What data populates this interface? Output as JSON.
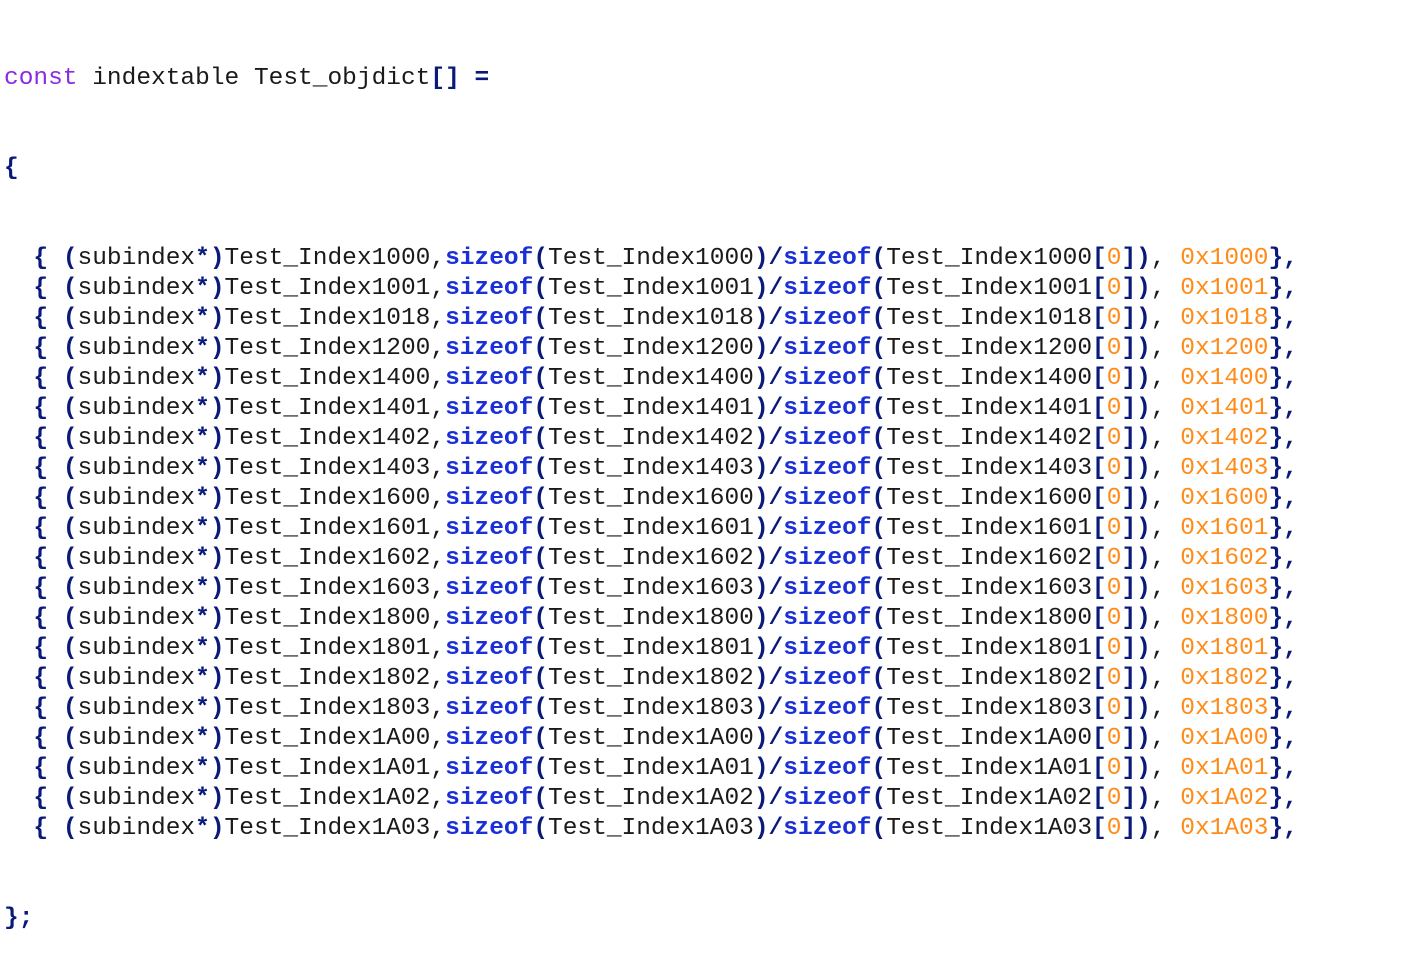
{
  "header": {
    "kw_const": "const",
    "rest": " indextable Test_objdict",
    "brackets": "[]",
    "equals": " ="
  },
  "open_brace": "{",
  "close_brace": "};",
  "entries": [
    {
      "index": "1000",
      "hex": "0x1000"
    },
    {
      "index": "1001",
      "hex": "0x1001"
    },
    {
      "index": "1018",
      "hex": "0x1018"
    },
    {
      "index": "1200",
      "hex": "0x1200"
    },
    {
      "index": "1400",
      "hex": "0x1400"
    },
    {
      "index": "1401",
      "hex": "0x1401"
    },
    {
      "index": "1402",
      "hex": "0x1402"
    },
    {
      "index": "1403",
      "hex": "0x1403"
    },
    {
      "index": "1600",
      "hex": "0x1600"
    },
    {
      "index": "1601",
      "hex": "0x1601"
    },
    {
      "index": "1602",
      "hex": "0x1602"
    },
    {
      "index": "1603",
      "hex": "0x1603"
    },
    {
      "index": "1800",
      "hex": "0x1800"
    },
    {
      "index": "1801",
      "hex": "0x1801"
    },
    {
      "index": "1802",
      "hex": "0x1802"
    },
    {
      "index": "1803",
      "hex": "0x1803"
    },
    {
      "index": "1A00",
      "hex": "0x1A00"
    },
    {
      "index": "1A01",
      "hex": "0x1A01"
    },
    {
      "index": "1A02",
      "hex": "0x1A02"
    },
    {
      "index": "1A03",
      "hex": "0x1A03"
    }
  ],
  "tokens": {
    "indent": "  ",
    "lbrace": "{",
    "lparen_cast": "(",
    "cast_type": "subindex",
    "star_rparen": "*)",
    "prefix": "Test_Index",
    "comma": ",",
    "sizeof": "sizeof",
    "lparen": "(",
    "rparen_div": ")/",
    "lbracket": "[",
    "zero": "0",
    "rbracket_paren": "])",
    "comma_sp": ", ",
    "rbrace_comma": "},"
  },
  "colors": {
    "keyword": "#1a2fd6",
    "symbol": "#0a1a7a",
    "number": "#ff8c1a",
    "type": "#8a2be2",
    "text": "#1a1a1a"
  }
}
